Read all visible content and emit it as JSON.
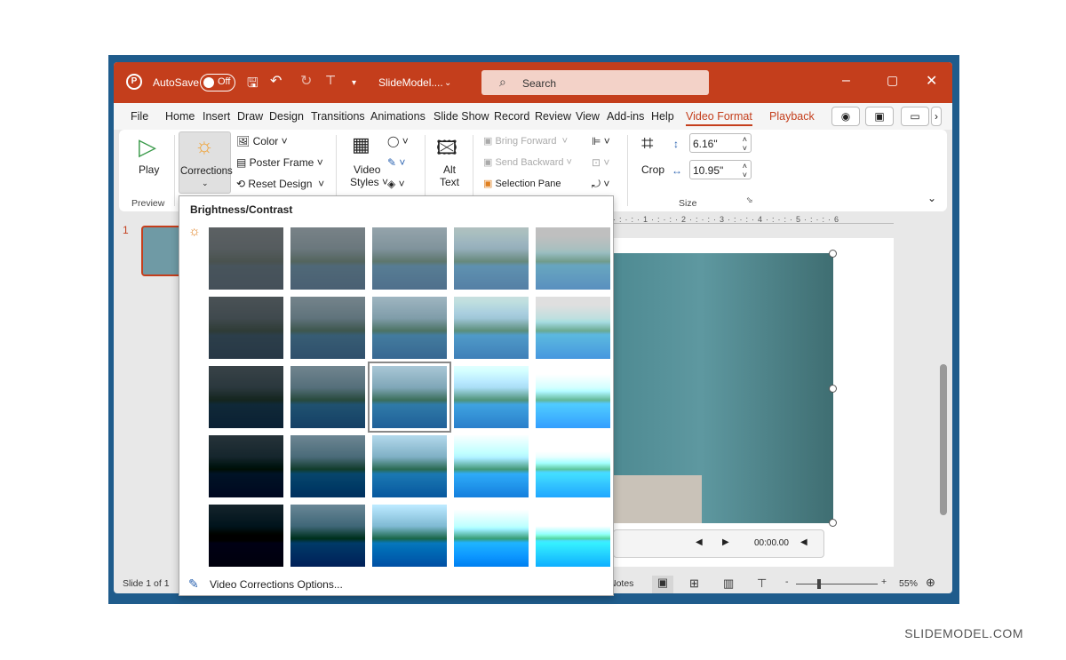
{
  "titlebar": {
    "autosave_label": "AutoSave",
    "autosave_state": "Off",
    "filename": "SlideModel....",
    "search_placeholder": "Search",
    "accent": "#c43e1c"
  },
  "tabs": [
    {
      "label": "File"
    },
    {
      "label": "Home"
    },
    {
      "label": "Insert"
    },
    {
      "label": "Draw"
    },
    {
      "label": "Design"
    },
    {
      "label": "Transitions"
    },
    {
      "label": "Animations"
    },
    {
      "label": "Slide Show"
    },
    {
      "label": "Record"
    },
    {
      "label": "Review"
    },
    {
      "label": "View"
    },
    {
      "label": "Add-ins"
    },
    {
      "label": "Help"
    },
    {
      "label": "Video Format",
      "active": true
    },
    {
      "label": "Playback"
    }
  ],
  "ribbon": {
    "play": "Play",
    "preview_group": "Preview",
    "corrections": "Corrections",
    "color": "Color",
    "poster_frame": "Poster Frame",
    "reset_design": "Reset Design",
    "video_styles_1": "Video",
    "video_styles_2": "Styles",
    "alt_text_1": "Alt",
    "alt_text_2": "Text",
    "bring_forward": "Bring Forward",
    "send_backward": "Send Backward",
    "selection_pane": "Selection Pane",
    "crop": "Crop",
    "height": "6.16\"",
    "width": "10.95\"",
    "size_group": "Size"
  },
  "popup": {
    "heading": "Brightness/Contrast",
    "options_link": "Video Corrections Options...",
    "brightness_levels": [
      -40,
      -20,
      0,
      20,
      40
    ],
    "contrast_levels": [
      -40,
      -20,
      0,
      20,
      40
    ],
    "selected": {
      "brightness": 0,
      "contrast": 0
    }
  },
  "slides": {
    "number": "1"
  },
  "video": {
    "time": "00:00.00"
  },
  "status": {
    "slide_count": "Slide 1 of 1",
    "notes": "Notes",
    "zoom": "55%",
    "zoom_fraction": 0.55
  },
  "watermark": "SLIDEMODEL.COM"
}
